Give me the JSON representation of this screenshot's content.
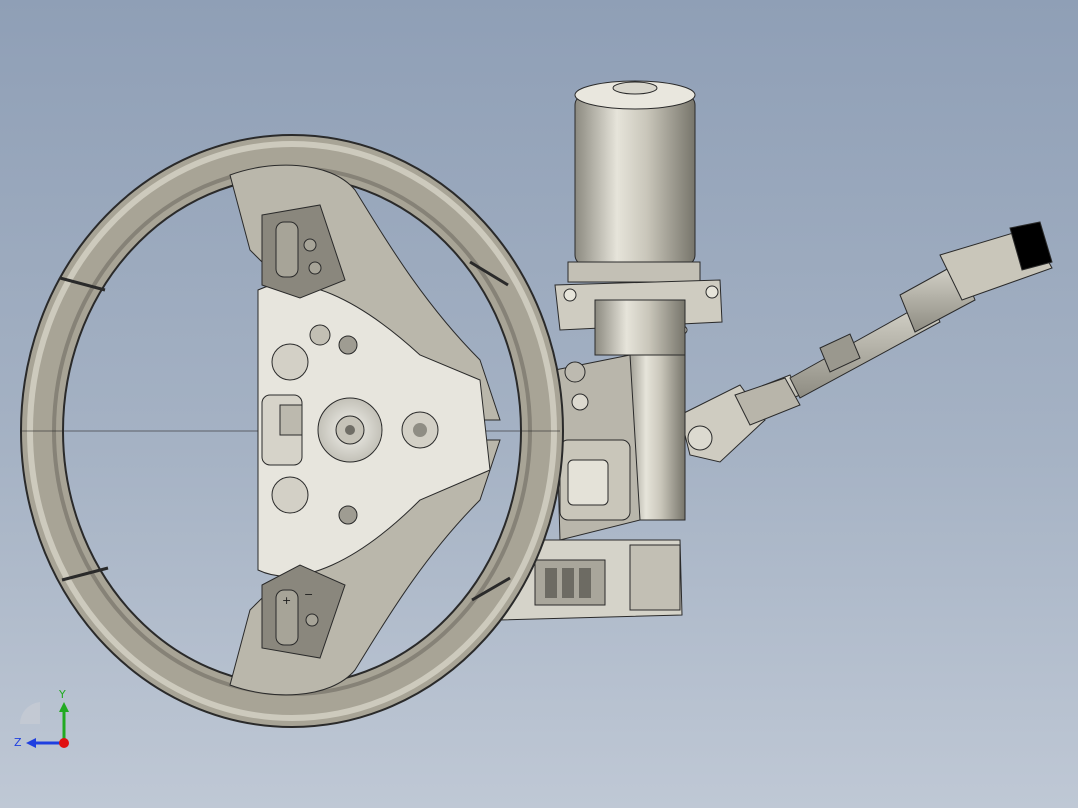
{
  "view": {
    "background_top": "#8f9fb6",
    "background_bottom": "#bfc8d5"
  },
  "model": {
    "parts": [
      "steering-wheel",
      "steering-column",
      "electric-motor",
      "intermediate-shaft",
      "universal-joint",
      "ecu-module"
    ],
    "wheel_button_labels": [
      "+",
      "−",
      "+",
      "−"
    ]
  },
  "triad": {
    "y_label": "Y",
    "z_label": "Z",
    "y_color": "#22aa22",
    "z_color": "#1f3fe0",
    "x_color": "#e01010"
  }
}
